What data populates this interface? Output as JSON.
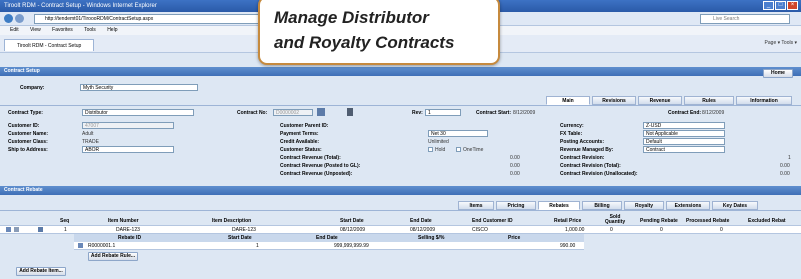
{
  "window": {
    "title": "Tiroolt RDM - Contract Setup - Windows Internet Explorer"
  },
  "address": {
    "url": "http://tendemt01/TiroooRDM/ContractSetup.aspx",
    "search_placeholder": "Live Search"
  },
  "menu": [
    "Edit",
    "View",
    "Favorites",
    "Tools",
    "Help"
  ],
  "browser_tab": {
    "label": "Tiroolt RDM - Contract Setup",
    "tools": "Page ▾  Tools ▾"
  },
  "callout": {
    "line1": "Manage Distributor",
    "line2": "and Royalty Contracts"
  },
  "contract_setup": {
    "header": "Contract Setup",
    "home_button": "Home",
    "company_label": "Company:",
    "company_value": "Myth Security",
    "contract_type_label": "Contract Type:",
    "contract_type_value": "Distributor",
    "contract_no_label": "Contract No:",
    "contract_no_value": "D0000002",
    "rev_label": "Rev:",
    "rev_value": "1",
    "contract_start_label": "Contract Start:",
    "contract_start_value": "8/12/2009",
    "contract_end_label": "Contract End:",
    "contract_end_value": "8/12/2009",
    "tabs": [
      "Main",
      "Revisions",
      "Revenue",
      "Rules",
      "Information"
    ],
    "left_fields": [
      {
        "label": "Customer ID:",
        "value": "47007"
      },
      {
        "label": "Customer Name:",
        "value": "Adult"
      },
      {
        "label": "Customer Class:",
        "value": "TRADE"
      },
      {
        "label": "Ship to Address:",
        "value": "ABOR"
      }
    ],
    "mid_fields": [
      {
        "label": "Customer Parent ID:",
        "value": ""
      },
      {
        "label": "Payment Terms:",
        "value": "Net 30"
      },
      {
        "label": "Credit Available:",
        "value": "Unlimited"
      },
      {
        "label": "Customer Status:",
        "value": ""
      },
      {
        "label": "Contract Revenue (Total):",
        "value": "0.00"
      },
      {
        "label": "Contract Revenue (Posted to GL):",
        "value": "0.00"
      },
      {
        "label": "Contract Revenue (Unposted):",
        "value": "0.00"
      }
    ],
    "status_options": [
      "Hold",
      "OneTime"
    ],
    "right_fields": [
      {
        "label": "Currency:",
        "value": "Z-USD"
      },
      {
        "label": "FX Table:",
        "value": "Not Applicable"
      },
      {
        "label": "Posting Accounts:",
        "value": "Default"
      },
      {
        "label": "Revenue Managed By:",
        "value": "Contract"
      },
      {
        "label": "Contract Revision:",
        "value": "1"
      },
      {
        "label": "Contract Revision (Total):",
        "value": "0.00"
      },
      {
        "label": "Contract Revision (Unallocated):",
        "value": "0.00"
      }
    ]
  },
  "contract_rebate": {
    "header": "Contract Rebate",
    "tabs": [
      "Items",
      "Pricing",
      "Rebates",
      "Billing",
      "Royalty",
      "Extensions",
      "Key Dates"
    ],
    "columns": [
      "Seq",
      "Item Number",
      "Item Description",
      "Start Date",
      "End Date",
      "End Customer ID",
      "Retail Price",
      "Sold Quantity",
      "Pending Rebate",
      "Processed Rebate",
      "Excluded Rebat"
    ],
    "row": {
      "seq": "1",
      "item": "DARE-123",
      "desc": "DARE-123",
      "start": "08/12/2009",
      "end": "08/12/2009",
      "cust": "CISCO",
      "price": "1,000.00",
      "qty": "0",
      "pending": "0",
      "processed": "0"
    },
    "sub_columns": [
      "Rebate ID",
      "Start Date",
      "End Date",
      "Selling $/%",
      "Price"
    ],
    "sub_row": {
      "id": "R0000001.1",
      "start": "1",
      "end": "999,999,999.99",
      "selling": "",
      "price": "990.00"
    },
    "add_rule_button": "Add Rebate Rule...",
    "add_item_button": "Add Rebate Item..."
  },
  "colors": {
    "accent": "#3e6fb6",
    "callout_border": "#c68a3e"
  }
}
